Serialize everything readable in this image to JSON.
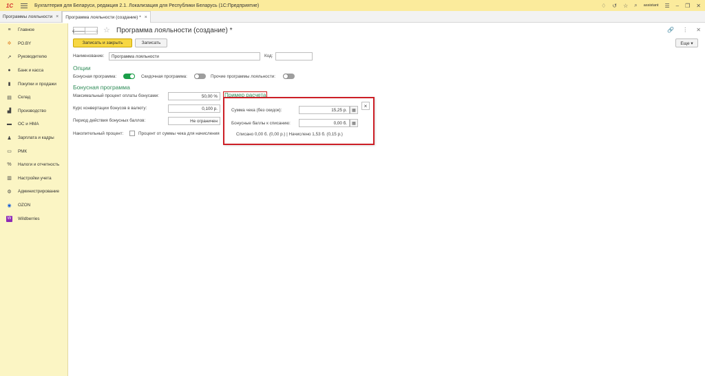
{
  "titlebar": {
    "logo": "1С",
    "title": "Бухгалтерия для Беларуси, редакция 2.1. Локализация для Республики Беларусь   (1С:Предприятие)",
    "user": "assistant"
  },
  "tabs": [
    {
      "label": "Программы лояльности"
    },
    {
      "label": "Программа лояльности (создание) *"
    }
  ],
  "sidebar": {
    "items": [
      {
        "label": "Главное",
        "icon": "≡"
      },
      {
        "label": "PO.BY",
        "icon": "✲"
      },
      {
        "label": "Руководителю",
        "icon": "↗"
      },
      {
        "label": "Банк и касса",
        "icon": "●"
      },
      {
        "label": "Покупки и продажи",
        "icon": "▮"
      },
      {
        "label": "Склад",
        "icon": "▤"
      },
      {
        "label": "Производство",
        "icon": "▟"
      },
      {
        "label": "ОС и НМА",
        "icon": "▬"
      },
      {
        "label": "Зарплата и кадры",
        "icon": "♟"
      },
      {
        "label": "РМК",
        "icon": "▭"
      },
      {
        "label": "Налоги и отчетность",
        "icon": "%"
      },
      {
        "label": "Настройки учета",
        "icon": "▥"
      },
      {
        "label": "Администрирование",
        "icon": "⚙"
      },
      {
        "label": "OZON",
        "icon": "◉"
      },
      {
        "label": "Wildberries",
        "icon": "W"
      }
    ]
  },
  "header": {
    "title": "Программа лояльности (создание) *",
    "save_close": "Записать и закрыть",
    "save": "Записать",
    "more": "Еще ▾"
  },
  "form": {
    "name_label": "Наименование:",
    "name_value": "Программа лояльности",
    "code_label": "Код:",
    "code_value": "",
    "options_title": "Опции",
    "bonus_program_label": "Бонусная программа:",
    "discount_program_label": "Скидочная программа:",
    "other_programs_label": "Прочие программы лояльности:",
    "bonus_section_title": "Бонусная программа",
    "max_percent_label": "Максимальный процент оплаты бонусами:",
    "max_percent_value": "50,00 %",
    "rate_label": "Курс конвертации бонусов в валюту:",
    "rate_value": "0,100 р.",
    "period_label": "Период действия бонусных баллов:",
    "period_value": "Не ограничен",
    "accum_label": "Накопительный процент:",
    "accum_text": "Процент от суммы чека для начисления",
    "example_link": "Пример расчета"
  },
  "toggles": {
    "bonus_program": true,
    "discount_program": false,
    "other_programs": false
  },
  "popup": {
    "check_sum_label": "Сумма чека (без скидок):",
    "check_sum_value": "15,25 р.",
    "bonus_label": "Бонусные баллы к списанию:",
    "bonus_value": "0,00 б.",
    "result": "Списано 0,00 б. (0,00 р.) | Начислено 1,53 б. (0,15 р.)",
    "close": "×"
  }
}
